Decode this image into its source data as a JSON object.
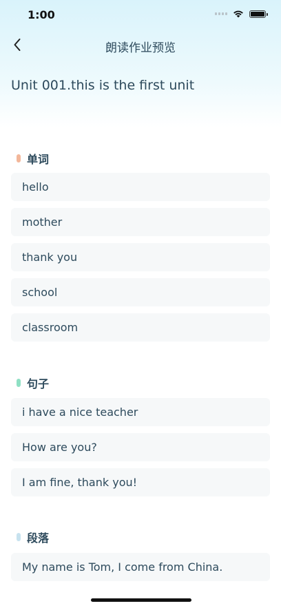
{
  "status": {
    "time": "1:00"
  },
  "nav": {
    "title": "朗读作业预览"
  },
  "unit_title": "Unit 001.this is the first unit",
  "colors": {
    "words_dot": "#f3b79a",
    "sentences_dot": "#8fe0c4",
    "paragraphs_dot": "#c7e2ef"
  },
  "sections": {
    "words": {
      "title": "单词",
      "items": [
        "hello",
        "mother",
        "thank you",
        "school",
        "classroom"
      ]
    },
    "sentences": {
      "title": "句子",
      "items": [
        "i have a nice teacher",
        "How are you?",
        "I am fine, thank you!"
      ]
    },
    "paragraphs": {
      "title": "段落",
      "items": [
        "My name is Tom, I come from China."
      ]
    }
  }
}
